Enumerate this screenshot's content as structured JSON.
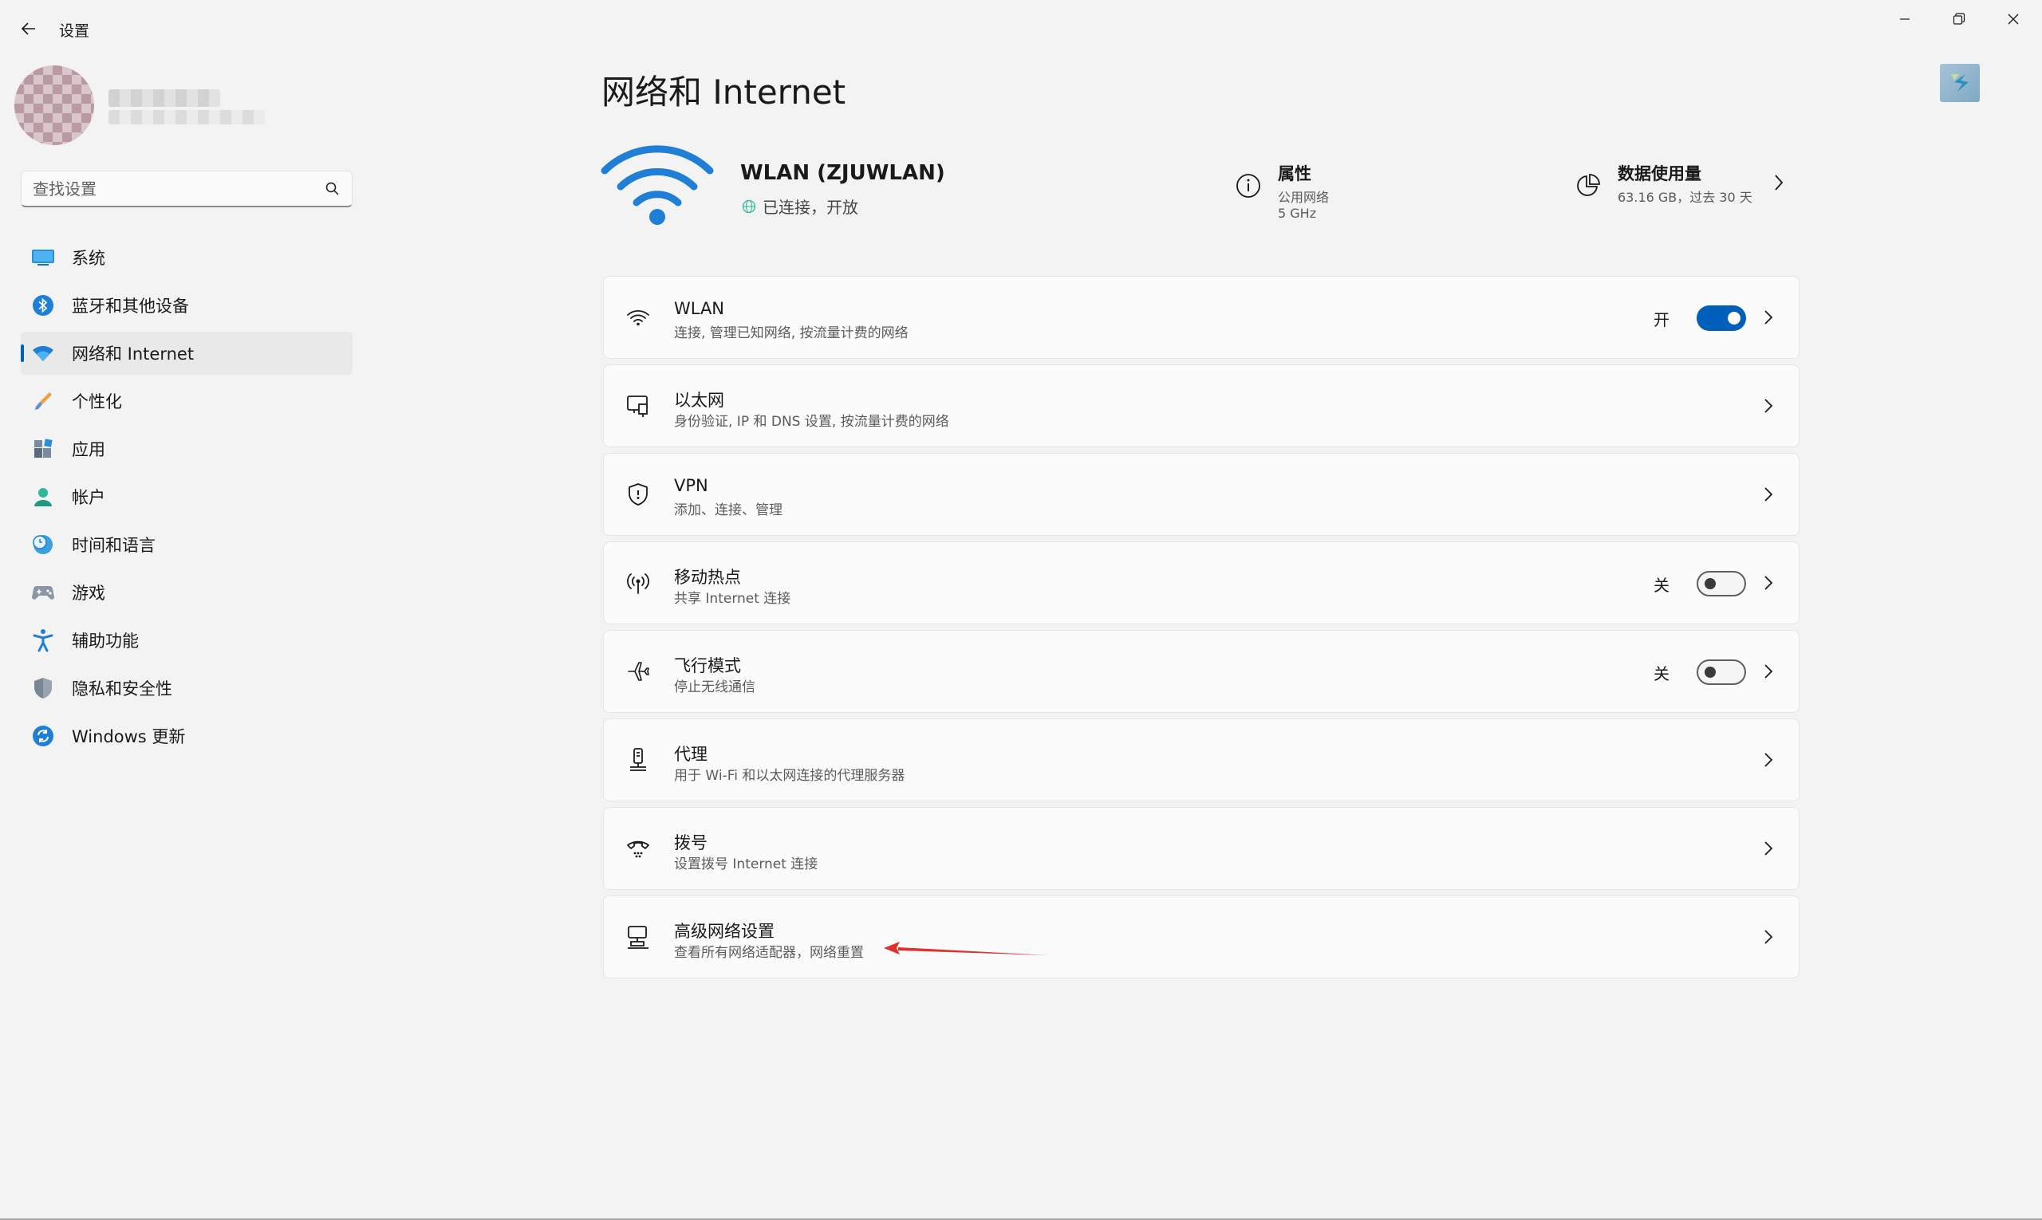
{
  "window": {
    "app_title": "设置",
    "controls": [
      "minimize",
      "maximize",
      "close"
    ]
  },
  "search": {
    "placeholder": "查找设置"
  },
  "sidebar": {
    "items": [
      {
        "label": "系统",
        "icon": "system-icon",
        "active": false
      },
      {
        "label": "蓝牙和其他设备",
        "icon": "bluetooth-icon",
        "active": false
      },
      {
        "label": "网络和 Internet",
        "icon": "network-icon",
        "active": true
      },
      {
        "label": "个性化",
        "icon": "brush-icon",
        "active": false
      },
      {
        "label": "应用",
        "icon": "apps-icon",
        "active": false
      },
      {
        "label": "帐户",
        "icon": "account-icon",
        "active": false
      },
      {
        "label": "时间和语言",
        "icon": "clock-globe-icon",
        "active": false
      },
      {
        "label": "游戏",
        "icon": "gamepad-icon",
        "active": false
      },
      {
        "label": "辅助功能",
        "icon": "accessibility-icon",
        "active": false
      },
      {
        "label": "隐私和安全性",
        "icon": "shield-icon",
        "active": false
      },
      {
        "label": "Windows 更新",
        "icon": "update-icon",
        "active": false
      }
    ]
  },
  "main": {
    "title": "网络和 Internet",
    "connection": {
      "name": "WLAN (ZJUWLAN)",
      "status": "已连接，开放"
    },
    "properties": {
      "title": "属性",
      "line1": "公用网络",
      "line2": "5 GHz"
    },
    "data_usage": {
      "title": "数据使用量",
      "detail": "63.16 GB，过去 30 天"
    },
    "cards": [
      {
        "title": "WLAN",
        "subtitle": "连接, 管理已知网络, 按流量计费的网络",
        "icon": "wifi-icon",
        "toggle": "on",
        "toggle_label": "开"
      },
      {
        "title": "以太网",
        "subtitle": "身份验证, IP 和 DNS 设置, 按流量计费的网络",
        "icon": "ethernet-icon"
      },
      {
        "title": "VPN",
        "subtitle": "添加、连接、管理",
        "icon": "vpn-shield-icon"
      },
      {
        "title": "移动热点",
        "subtitle": "共享 Internet 连接",
        "icon": "hotspot-icon",
        "toggle": "off",
        "toggle_label": "关"
      },
      {
        "title": "飞行模式",
        "subtitle": "停止无线通信",
        "icon": "airplane-icon",
        "toggle": "off",
        "toggle_label": "关"
      },
      {
        "title": "代理",
        "subtitle": "用于 Wi-Fi 和以太网连接的代理服务器",
        "icon": "proxy-icon"
      },
      {
        "title": "拨号",
        "subtitle": "设置拨号 Internet 连接",
        "icon": "dialup-icon"
      },
      {
        "title": "高级网络设置",
        "subtitle": "查看所有网络适配器，网络重置",
        "icon": "advanced-network-icon"
      }
    ]
  },
  "colors": {
    "accent": "#005fb8",
    "background": "#f3f3f3",
    "card": "#fbfbfb",
    "annotation_arrow": "#e03030"
  }
}
